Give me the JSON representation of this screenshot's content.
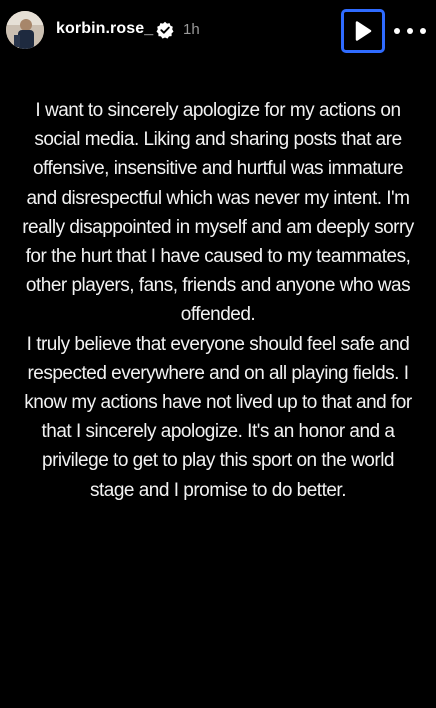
{
  "header": {
    "username": "korbin.rose_",
    "verified_icon": "verified-badge-icon",
    "timestamp": "1h",
    "play_icon": "play-icon",
    "more_icon": "more-horizontal-icon"
  },
  "colors": {
    "background": "#000000",
    "text": "#f2f2f2",
    "timestamp": "#9a9a9a",
    "focus_outline": "#2f6bff"
  },
  "story": {
    "paragraph_1": "I want to sincerely apologize for my actions on social media. Liking and sharing posts that are offensive, insensitive and hurtful was immature and disrespectful which was never my intent. I'm really disappointed in myself and am deeply sorry for the hurt that I have caused to my teammates, other players, fans, friends and anyone who was offended.",
    "paragraph_2": "I truly believe that everyone should feel safe and respected everywhere and on all playing fields. I know my actions have not lived up to that and for that I sincerely apologize. It's an honor and a privilege to get to play this sport on the world stage and I promise to do better."
  }
}
